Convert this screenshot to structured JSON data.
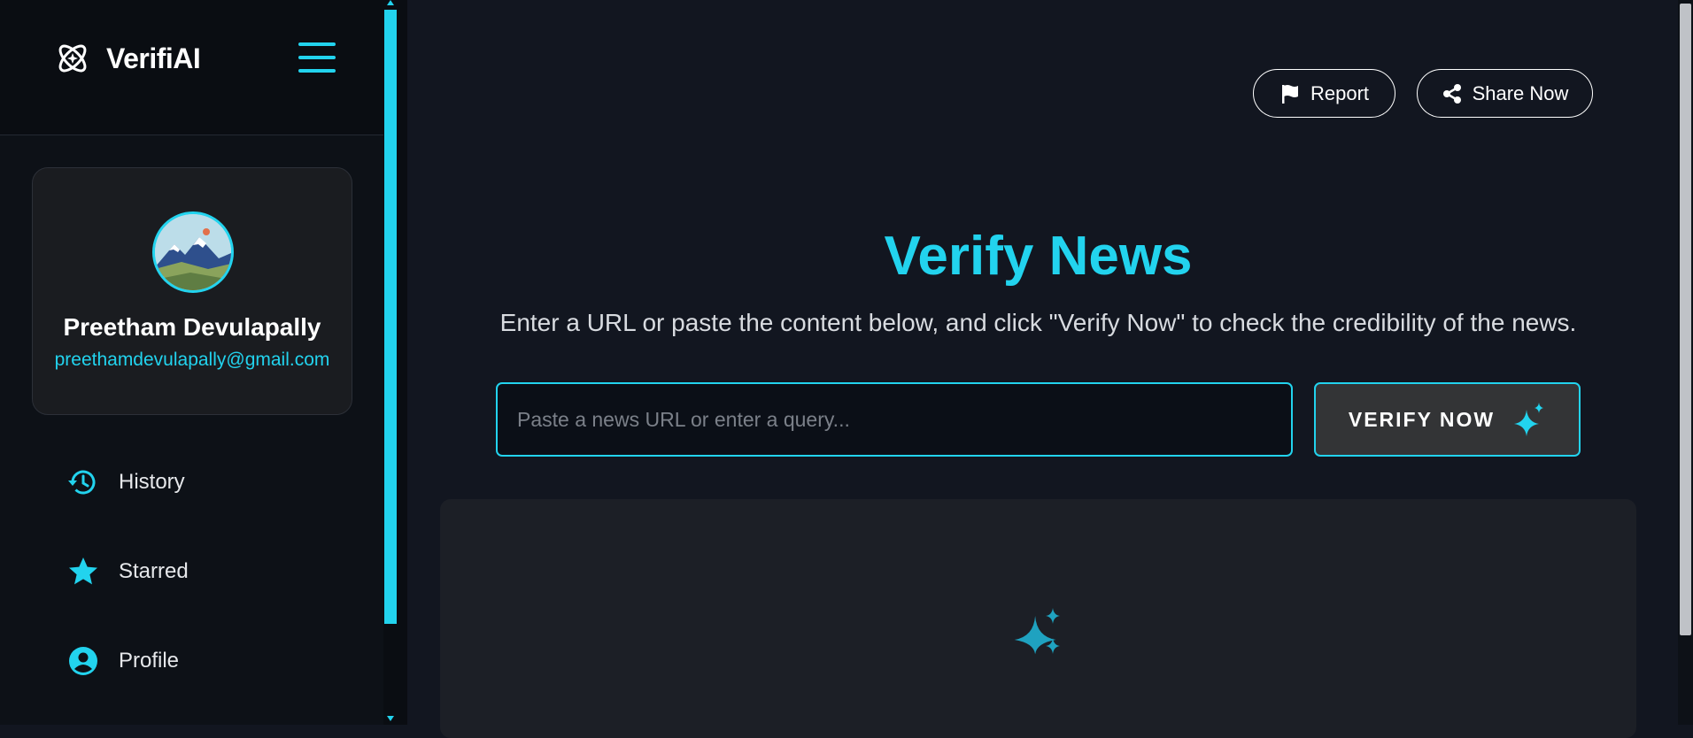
{
  "app": {
    "name": "VerifiAI",
    "logo_icon": "atom-logo-icon",
    "accent_color": "#22d3ee"
  },
  "sidebar": {
    "menu_icon": "hamburger-menu-icon",
    "profile": {
      "name": "Preetham Devulapally",
      "email": "preethamdevulapally@gmail.com",
      "avatar_icon": "mountain-landscape-avatar"
    },
    "items": [
      {
        "label": "History",
        "icon": "history-icon"
      },
      {
        "label": "Starred",
        "icon": "star-icon"
      },
      {
        "label": "Profile",
        "icon": "user-circle-icon"
      }
    ]
  },
  "header": {
    "report_label": "Report",
    "report_icon": "flag-icon",
    "share_label": "Share Now",
    "share_icon": "share-icon"
  },
  "main": {
    "title": "Verify News",
    "subtitle": "Enter a URL or paste the content below, and click \"Verify Now\" to check the credibility of the news.",
    "input_placeholder": "Paste a news URL or enter a query...",
    "input_value": "",
    "verify_label": "VERIFY NOW",
    "verify_icon": "sparkle-icon",
    "result_icon": "sparkle-icon"
  }
}
